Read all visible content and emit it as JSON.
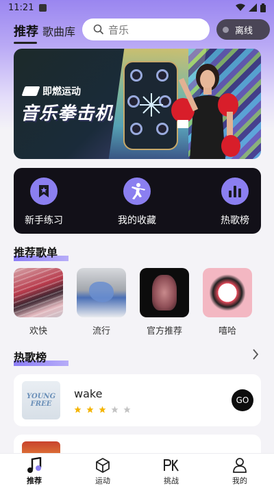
{
  "status_bar": {
    "time": "11:21"
  },
  "header": {
    "tabs": [
      {
        "label": "推荐",
        "active": true
      },
      {
        "label": "歌曲库",
        "active": false
      }
    ],
    "search_placeholder": "音乐",
    "offline_label": "离线"
  },
  "banner": {
    "brand": "即燃运动",
    "title": "音乐拳击机"
  },
  "quick_actions": [
    {
      "label": "新手练习",
      "icon": "bookmark-star-icon"
    },
    {
      "label": "我的收藏",
      "icon": "fighter-kick-icon"
    },
    {
      "label": "热歌榜",
      "icon": "bar-chart-icon"
    }
  ],
  "recommended": {
    "title": "推荐歌单",
    "playlists": [
      {
        "label": "欢快"
      },
      {
        "label": "流行"
      },
      {
        "label": "官方推荐"
      },
      {
        "label": "嘻哈"
      }
    ]
  },
  "hot": {
    "title": "热歌榜",
    "songs": [
      {
        "cover_text_1": "YOUNG",
        "cover_text_2": "FREE",
        "name": "wake",
        "rating": 3,
        "max_rating": 5,
        "action": "GO"
      }
    ]
  },
  "colors": {
    "accent": "#8b7ff0",
    "star_on": "#f4b400",
    "star_off": "#c4c4c4"
  },
  "bottom_nav": [
    {
      "label": "推荐",
      "icon": "music-note-icon",
      "active": true
    },
    {
      "label": "运动",
      "icon": "cube-icon",
      "active": false
    },
    {
      "label": "挑战",
      "icon": "pk-icon",
      "active": false
    },
    {
      "label": "我的",
      "icon": "profile-icon",
      "active": false
    }
  ]
}
